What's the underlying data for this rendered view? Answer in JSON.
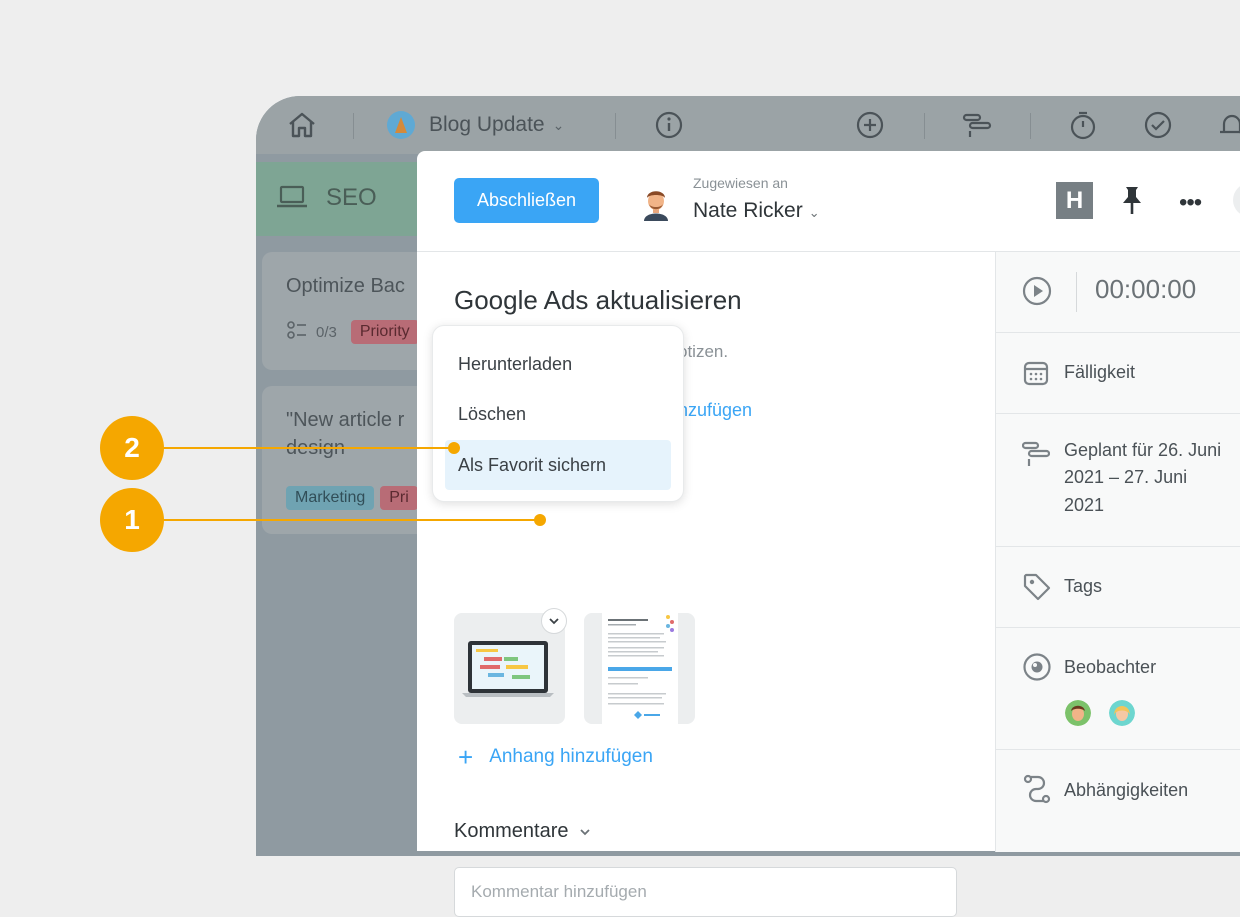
{
  "app": {
    "project": {
      "name": "Blog Update"
    },
    "column": {
      "title": "SEO"
    },
    "cards": [
      {
        "title": "Optimize Bac",
        "subtasks": "0/3",
        "tags": [
          "Priority"
        ]
      },
      {
        "title": "\"New article r",
        "title2": "design",
        "tags": [
          "Marketing",
          "Pri"
        ]
      }
    ]
  },
  "task": {
    "complete_label": "Abschließen",
    "assigned_label": "Zugewiesen an",
    "assignee": "Nate Ricker",
    "badge": "H",
    "title": "Google Ads aktualisieren",
    "notes_partial": "otizen.",
    "add_partial": "nzufügen",
    "add_attachment": "Anhang hinzufügen",
    "comments_title": "Kommentare",
    "comment_placeholder": "Kommentar hinzufügen"
  },
  "sidebar": {
    "timer": "00:00:00",
    "due": "Fälligkeit",
    "planned_line1": "Geplant für 26. Juni",
    "planned_line2": "2021 – 27. Juni",
    "planned_line3": "2021",
    "tags": "Tags",
    "watchers": "Beobachter",
    "dependencies": "Abhängigkeiten"
  },
  "menu": {
    "items": [
      "Herunterladen",
      "Löschen",
      "Als Favorit sichern"
    ]
  },
  "callouts": {
    "one": "1",
    "two": "2"
  },
  "colors": {
    "accent": "#3aa5f5",
    "callout": "#f5a700"
  }
}
